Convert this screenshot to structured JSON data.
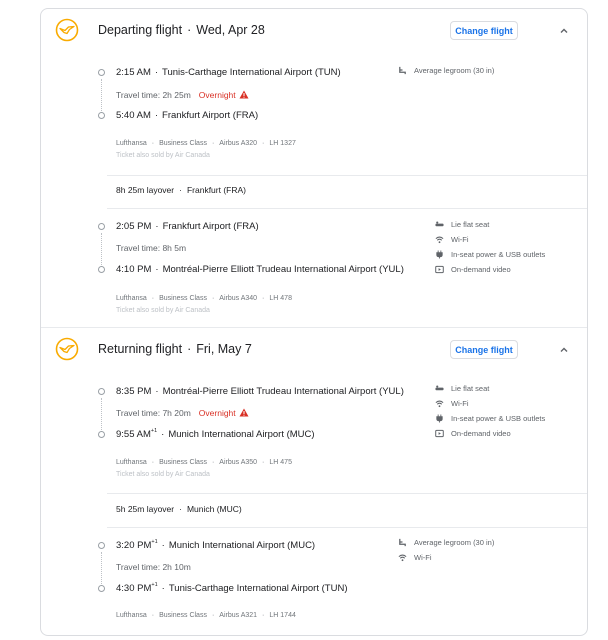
{
  "departing": {
    "title": "Departing flight",
    "date": "Wed, Apr 28",
    "change_label": "Change flight",
    "segments": [
      {
        "dep_time": "2:15 AM",
        "dep_airport": "Tunis-Carthage International Airport (TUN)",
        "travel_time": "Travel time: 2h 25m",
        "overnight": "Overnight",
        "arr_time": "5:40 AM",
        "arr_airport": "Frankfurt Airport (FRA)",
        "airline": "Lufthansa",
        "cabin": "Business Class",
        "aircraft": "Airbus A320",
        "flight_no": "LH 1327",
        "sold_by": "Ticket also sold by Air Canada",
        "amenities": [
          "Average legroom (30 in)"
        ]
      },
      {
        "dep_time": "2:05 PM",
        "dep_airport": "Frankfurt Airport (FRA)",
        "travel_time": "Travel time: 8h 5m",
        "arr_time": "4:10 PM",
        "arr_airport": "Montréal-Pierre Elliott Trudeau International Airport (YUL)",
        "airline": "Lufthansa",
        "cabin": "Business Class",
        "aircraft": "Airbus A340",
        "flight_no": "LH 478",
        "sold_by": "Ticket also sold by Air Canada",
        "amenities": [
          "Lie flat seat",
          "Wi-Fi",
          "In-seat power & USB outlets",
          "On-demand video"
        ]
      }
    ],
    "layover": {
      "duration": "8h 25m layover",
      "place": "Frankfurt (FRA)"
    }
  },
  "returning": {
    "title": "Returning flight",
    "date": "Fri, May 7",
    "change_label": "Change flight",
    "segments": [
      {
        "dep_time": "8:35 PM",
        "dep_airport": "Montréal-Pierre Elliott Trudeau International Airport (YUL)",
        "travel_time": "Travel time: 7h 20m",
        "overnight": "Overnight",
        "arr_time": "9:55 AM",
        "arr_plus": "+1",
        "arr_airport": "Munich International Airport (MUC)",
        "airline": "Lufthansa",
        "cabin": "Business Class",
        "aircraft": "Airbus A350",
        "flight_no": "LH 475",
        "sold_by": "Ticket also sold by Air Canada",
        "amenities": [
          "Lie flat seat",
          "Wi-Fi",
          "In-seat power & USB outlets",
          "On-demand video"
        ]
      },
      {
        "dep_time": "3:20 PM",
        "dep_plus": "+1",
        "dep_airport": "Munich International Airport (MUC)",
        "travel_time": "Travel time: 2h 10m",
        "arr_time": "4:30 PM",
        "arr_plus": "+1",
        "arr_airport": "Tunis-Carthage International Airport (TUN)",
        "airline": "Lufthansa",
        "cabin": "Business Class",
        "aircraft": "Airbus A321",
        "flight_no": "LH 1744",
        "amenities": [
          "Average legroom (30 in)",
          "Wi-Fi"
        ]
      }
    ],
    "layover": {
      "duration": "5h 25m layover",
      "place": "Munich (MUC)"
    }
  },
  "icons": {
    "logo": "lufthansa-crane-logo",
    "chevron": "chevron-up-icon",
    "warning": "warning-triangle-icon",
    "legroom": "legroom-seat-icon",
    "lieflat": "lie-flat-seat-icon",
    "wifi": "wifi-icon",
    "power": "power-plug-icon",
    "video": "video-icon"
  },
  "colors": {
    "brand_logo": "#f9ab00",
    "link": "#1a73e8",
    "warning": "#d93025"
  }
}
